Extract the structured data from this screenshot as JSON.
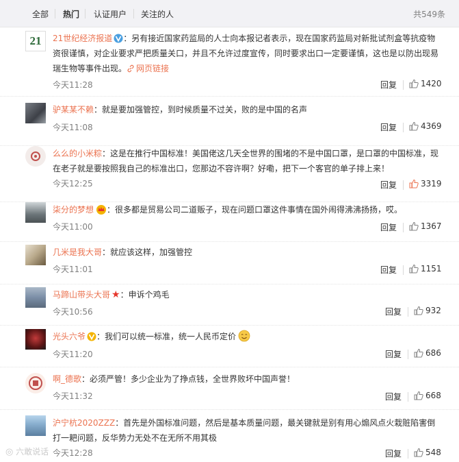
{
  "tabs": {
    "all": "全部",
    "hot": "热门",
    "verified": "认证用户",
    "following": "关注的人",
    "total": "共549条"
  },
  "reply_label": "回复",
  "comments": [
    {
      "user": "21世纪经济报道",
      "text": "：另有接近国家药监局的人士向本报记者表示，现在国家药监局对新批试剂盒等抗疫物资很谨慎，对企业要求严把质量关口，并且不允许过度宣传，同时要求出口一定要谨慎，这也是以防出现易瑞生物等事件出现。",
      "link": "网页链接",
      "time": "今天11:28",
      "likes": "1420",
      "avatar_text": "21"
    },
    {
      "user": "驴某某不赖",
      "text": "：就是要加强管控，到时候质量不过关，败的是中国的名声",
      "time": "今天11:08",
      "likes": "4369"
    },
    {
      "user": "么么的小米粽",
      "text": "：这是在推行中国标准！美国佬这几天全世界的围堵的不是中国口罩，是口罩的中国标准，现在老子就是要按照我自己的标准出口，您那边不容许啊？好嘞，把下一个客官的单子排上来！",
      "time": "今天12:25",
      "likes": "3319"
    },
    {
      "user": "柒分的梦想",
      "text": "：很多都是贸易公司二道贩子，现在问题口罩这件事情在国外闹得沸沸扬扬，哎。",
      "time": "今天11:00",
      "likes": "1367"
    },
    {
      "user": "几米是我大哥",
      "text": "：就应该这样，加强管控",
      "time": "今天11:01",
      "likes": "1151"
    },
    {
      "user": "马蹄山带头大哥",
      "text": "：申诉个鸡毛",
      "time": "今天10:56",
      "likes": "932"
    },
    {
      "user": "光头六爷",
      "text": "：我们可以统一标准，统一人民币定价",
      "time": "今天11:20",
      "likes": "686"
    },
    {
      "user": "啊_德歌",
      "text": "：必须严管！多少企业为了挣点钱，全世界败坏中国声誉！",
      "time": "今天11:32",
      "likes": "668"
    },
    {
      "user": "沪宁杭2020ZZZ",
      "text": "：首先是外国标准问题，然后是基本质量问题，最关键就是别有用心煽风点火栽赃陷害倒打一耙问题，反华势力无处不在无所不用其极",
      "time": "今天12:28",
      "likes": "548"
    }
  ],
  "watermark": "六敢说话",
  "colors": {
    "username": "#eb7350",
    "tab_bg": "#f2f2f5",
    "muted": "#808080",
    "verified_blue": "#4a9fe0",
    "verified_gold": "#f4b400",
    "star_red": "#e6362c",
    "hot_like": "#eb7350"
  }
}
